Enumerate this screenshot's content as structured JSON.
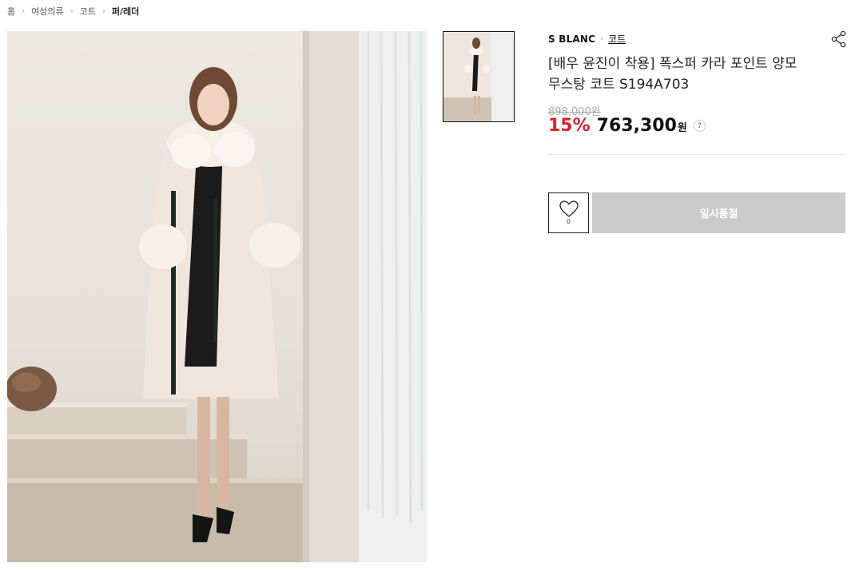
{
  "breadcrumb": {
    "items": [
      "홈",
      "여성의류",
      "코트",
      "퍼/레더"
    ]
  },
  "product": {
    "brand": "S BLANC",
    "category": "코트",
    "title": "[배우 윤진이 착용] 폭스퍼 카라 포인트 양모 무스탕 코트 S194A703",
    "original_price": "898,000원",
    "discount": "15%",
    "sale_price": "763,300",
    "currency": "원",
    "help_label": "?"
  },
  "actions": {
    "wish_count": "0",
    "soldout_label": "일시품절"
  },
  "icons": {
    "share": "share-icon",
    "heart": "heart-icon",
    "breadcrumb_separator": "chevron-right-icon"
  },
  "colors": {
    "discount": "#d6252f",
    "soldout_bg": "#cbcbcb",
    "text": "#222222"
  }
}
